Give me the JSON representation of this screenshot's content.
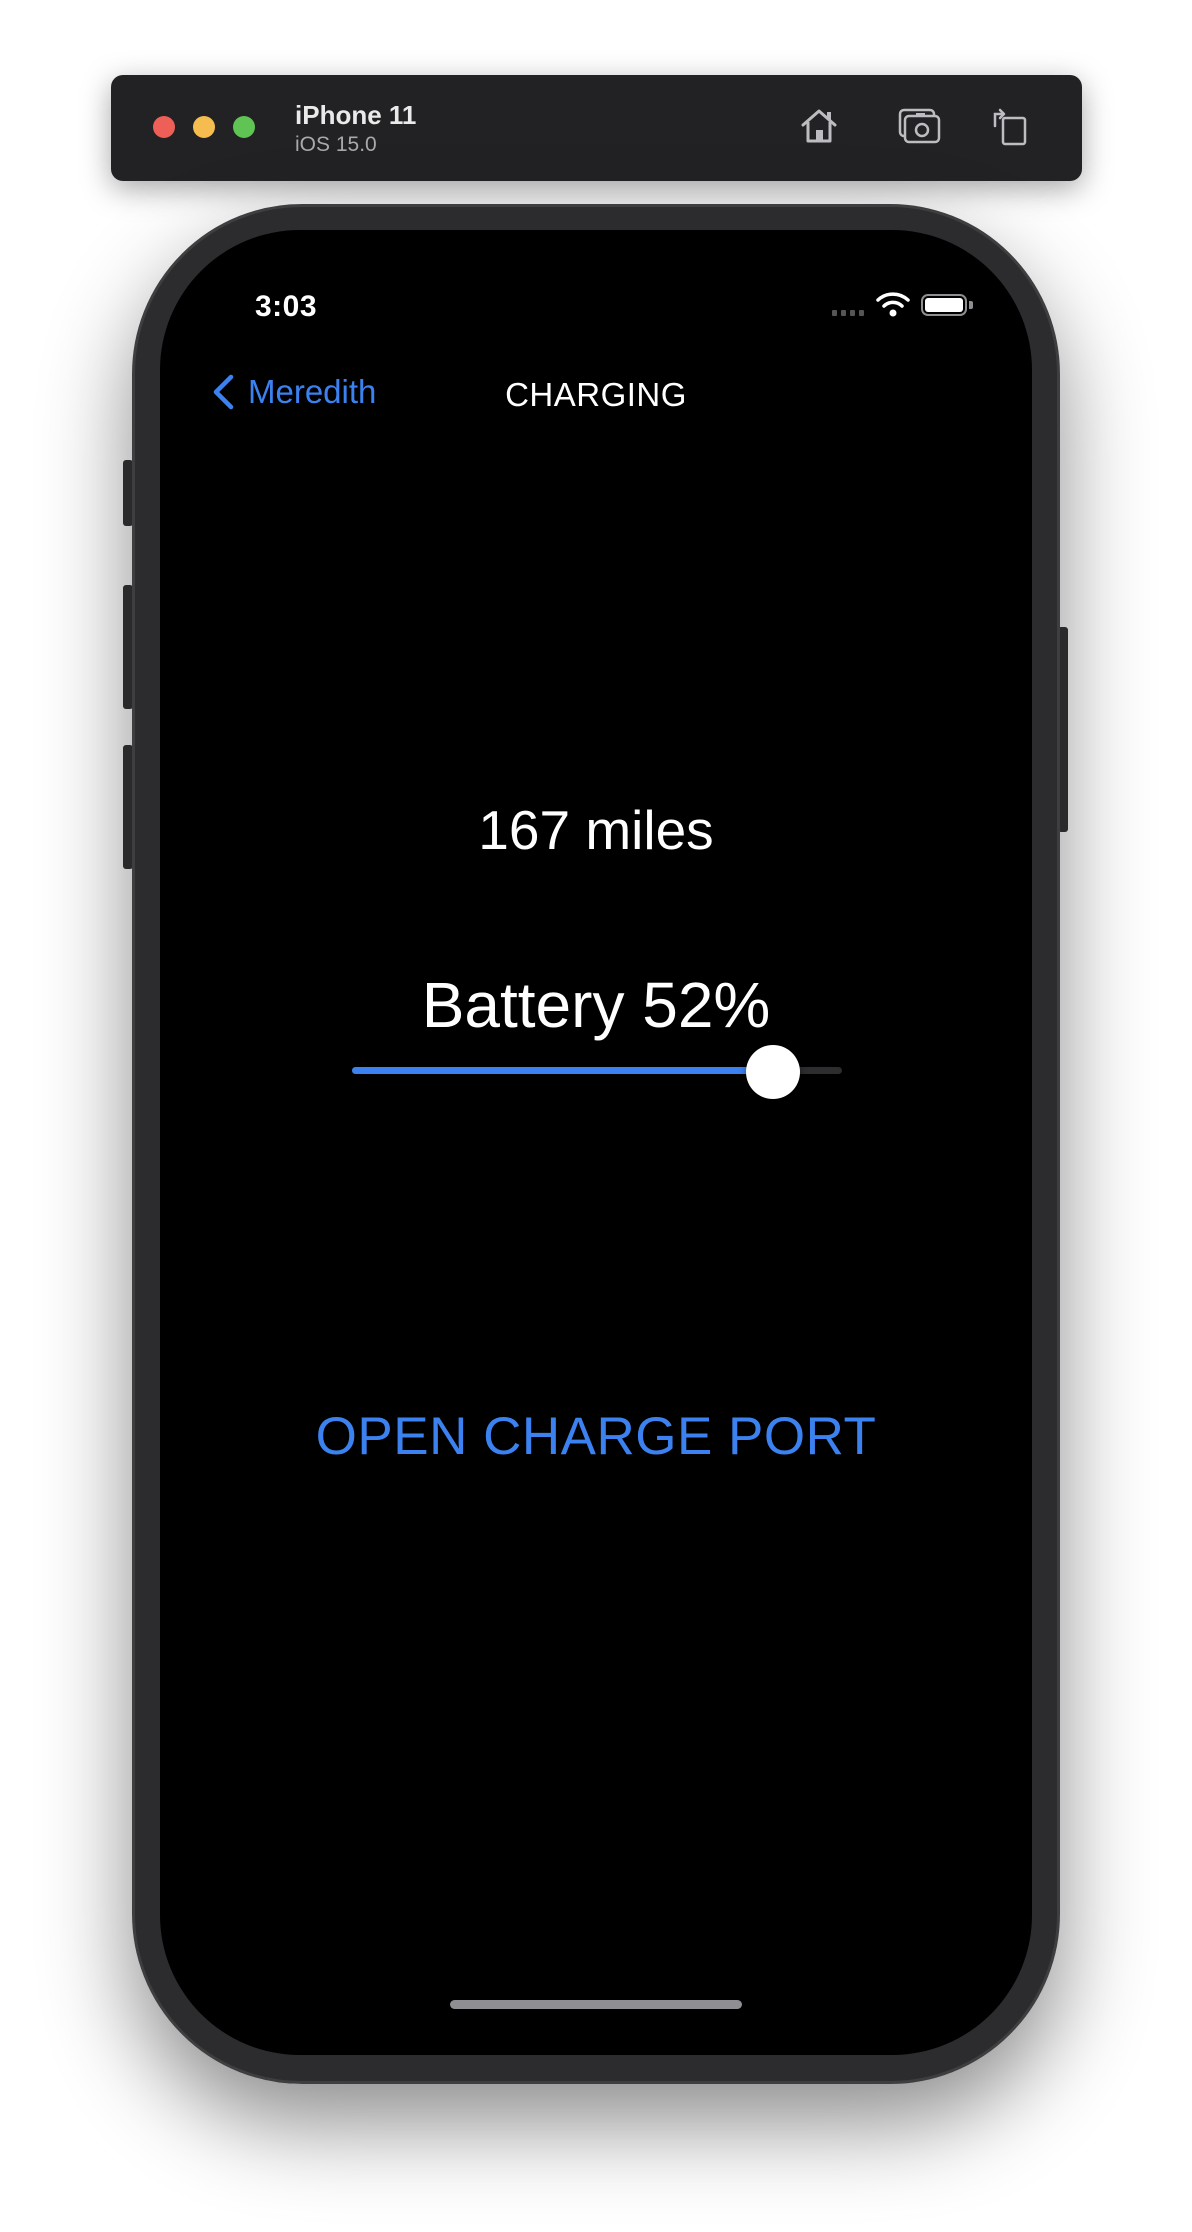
{
  "simulator": {
    "device_name": "iPhone 11",
    "os_version": "iOS 15.0",
    "toolbar_icons": [
      "home-icon",
      "screenshot-icon",
      "rotate-icon"
    ]
  },
  "status_bar": {
    "time": "3:03",
    "icons": [
      "cellular-signal-icon",
      "wifi-icon",
      "battery-icon"
    ]
  },
  "nav": {
    "back_label": "Meredith",
    "title": "CHARGING"
  },
  "content": {
    "range_text": "167 miles",
    "battery_text": "Battery 52%",
    "slider_level": 0.86,
    "open_charge_port_label": "OPEN CHARGE PORT"
  },
  "colors": {
    "accent": "#3b82f0",
    "background": "#000000",
    "text": "#ffffff"
  }
}
